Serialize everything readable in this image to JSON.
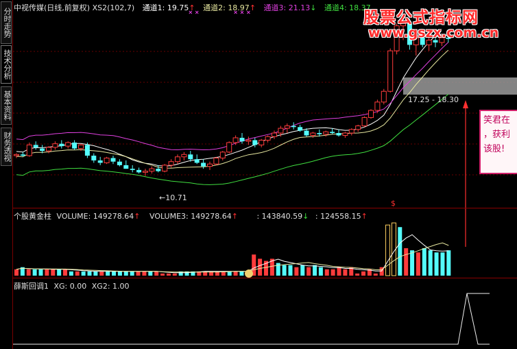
{
  "tabs": [
    {
      "label": "分时走势",
      "active": false
    },
    {
      "label": "技术分析",
      "active": true
    },
    {
      "label": "基本资料",
      "active": false
    },
    {
      "label": "财务透视",
      "active": false
    }
  ],
  "main_header": {
    "stock_name": "中视传媒(日线,前复权)",
    "indicator": "XS2(102,7)",
    "ch1_label": "通道1: ",
    "ch1_value": "19.75",
    "ch1_arrow": "↑",
    "ch2_label": "通道2: ",
    "ch2_value": "18.97",
    "ch2_arrow": "↑",
    "ch3_label": "通道3: ",
    "ch3_value": "21.13",
    "ch3_arrow": "↓",
    "ch4_label": "通道4: ",
    "ch4_value": "18.37"
  },
  "volume_header": {
    "name": "个股黄金柱",
    "vol_label": "VOLUME: ",
    "vol_value": "149278.64",
    "vol_arrow": "↑",
    "vol3_label": "VOLUME3: ",
    "vol3_value": "149278.64",
    "vol3_arrow": "↑",
    "ma1_value": ": 143840.59",
    "ma1_arrow": "↓",
    "ma2_value": ": 124558.15",
    "ma2_arrow": "↑"
  },
  "bottom_header": {
    "name": "薛斯回调1",
    "xg_label": "XG: ",
    "xg_value": "0.00",
    "xg2_label": "XG2: ",
    "xg2_value": "1.00"
  },
  "price_range_label": "17.25 - 18.30",
  "low_price_label": "←10.71",
  "dollar_mark": "$",
  "watermark": {
    "title": "股票公式指标网",
    "url": "www.gszx.com.cn"
  },
  "popup": {
    "line1": "笑君在",
    "line2": "，获利",
    "line3": "该股!"
  },
  "colors": {
    "up": "#ff3c3c",
    "down": "#54fcfc",
    "ch1": "#ffffff",
    "ch2": "#e8e8a0",
    "ch3": "#e040e0",
    "ch4": "#40e040",
    "separator": "#8a0000",
    "gray_band": "#9a9a9a"
  },
  "candles": [
    [
      13.7,
      13.9,
      13.5,
      13.8
    ],
    [
      13.8,
      14.0,
      13.6,
      13.7
    ],
    [
      13.7,
      14.8,
      13.6,
      14.6
    ],
    [
      14.6,
      14.9,
      14.2,
      14.4
    ],
    [
      14.3,
      14.6,
      13.9,
      14.1
    ],
    [
      14.1,
      14.5,
      13.9,
      14.4
    ],
    [
      14.4,
      14.9,
      14.2,
      14.7
    ],
    [
      14.7,
      15.0,
      14.3,
      14.5
    ],
    [
      14.5,
      14.9,
      14.3,
      14.8
    ],
    [
      14.8,
      15.0,
      14.2,
      14.3
    ],
    [
      14.3,
      14.7,
      14.1,
      14.6
    ],
    [
      14.6,
      14.8,
      13.5,
      13.7
    ],
    [
      13.7,
      13.9,
      13.1,
      13.3
    ],
    [
      13.3,
      13.6,
      12.9,
      13.1
    ],
    [
      13.1,
      13.6,
      13.0,
      13.5
    ],
    [
      13.5,
      13.7,
      13.0,
      13.2
    ],
    [
      13.2,
      13.4,
      12.8,
      12.9
    ],
    [
      12.9,
      13.3,
      12.6,
      12.6
    ],
    [
      12.6,
      12.9,
      12.3,
      12.5
    ],
    [
      12.5,
      12.7,
      12.2,
      12.3
    ],
    [
      12.3,
      12.6,
      12.0,
      12.4
    ],
    [
      12.4,
      12.8,
      12.2,
      12.6
    ],
    [
      12.6,
      12.9,
      12.3,
      12.4
    ],
    [
      12.4,
      13.0,
      12.3,
      12.9
    ],
    [
      12.9,
      13.4,
      12.7,
      13.2
    ],
    [
      13.2,
      13.8,
      13.0,
      13.6
    ],
    [
      13.6,
      14.0,
      13.3,
      13.8
    ],
    [
      13.8,
      14.1,
      13.2,
      13.4
    ],
    [
      13.4,
      13.8,
      13.0,
      13.1
    ],
    [
      13.1,
      13.4,
      12.6,
      12.8
    ],
    [
      12.8,
      13.2,
      12.5,
      13.0
    ],
    [
      13.0,
      13.6,
      12.9,
      13.5
    ],
    [
      13.5,
      14.1,
      13.3,
      14.0
    ],
    [
      14.0,
      14.9,
      13.9,
      14.8
    ],
    [
      14.8,
      15.4,
      14.6,
      15.2
    ],
    [
      15.2,
      15.6,
      14.7,
      14.9
    ],
    [
      14.9,
      15.3,
      14.6,
      15.0
    ],
    [
      15.0,
      15.2,
      14.4,
      14.6
    ],
    [
      14.6,
      15.1,
      14.4,
      15.0
    ],
    [
      15.0,
      15.4,
      14.8,
      15.3
    ],
    [
      15.3,
      15.8,
      15.1,
      15.6
    ],
    [
      15.6,
      16.2,
      15.3,
      16.0
    ],
    [
      16.0,
      16.4,
      15.6,
      16.2
    ],
    [
      16.2,
      16.5,
      15.9,
      16.1
    ],
    [
      16.1,
      16.3,
      15.7,
      15.8
    ],
    [
      15.8,
      16.0,
      15.3,
      15.4
    ],
    [
      15.4,
      15.7,
      15.2,
      15.6
    ],
    [
      15.6,
      15.9,
      15.3,
      15.5
    ],
    [
      15.5,
      15.8,
      15.3,
      15.7
    ],
    [
      15.7,
      16.0,
      15.5,
      15.6
    ],
    [
      15.6,
      15.9,
      15.3,
      15.4
    ],
    [
      15.4,
      15.7,
      15.2,
      15.6
    ],
    [
      15.6,
      16.0,
      15.4,
      15.9
    ],
    [
      15.9,
      16.3,
      15.7,
      16.2
    ],
    [
      16.2,
      17.0,
      16.1,
      16.9
    ],
    [
      16.9,
      17.6,
      16.8,
      17.5
    ],
    [
      17.5,
      18.4,
      17.3,
      18.2
    ],
    [
      18.2,
      19.3,
      18.0,
      19.1
    ],
    [
      19.1,
      22.7,
      19.0,
      22.5
    ],
    [
      22.5,
      24.8,
      22.2,
      24.6
    ],
    [
      24.6,
      25.0,
      23.4,
      24.8
    ],
    [
      24.8,
      25.2,
      22.6,
      23.0
    ],
    [
      23.0,
      23.9,
      22.1,
      23.6
    ],
    [
      23.6,
      23.9,
      22.8,
      23.0
    ],
    [
      23.0,
      23.6,
      22.5,
      23.4
    ],
    [
      23.4,
      23.8,
      22.8,
      23.2
    ],
    [
      23.2,
      23.9,
      22.9,
      23.6
    ],
    [
      23.6,
      23.9,
      23.2,
      23.5
    ]
  ],
  "volumes": [
    3,
    4,
    3,
    3,
    3,
    3,
    3,
    3,
    3,
    2,
    2,
    2,
    2,
    2,
    2,
    2,
    2,
    2,
    2,
    2,
    2,
    2,
    2,
    2,
    1,
    1,
    1,
    2,
    2,
    2,
    2,
    2,
    2,
    2,
    2,
    2,
    2,
    2,
    2,
    10,
    8,
    7,
    8,
    6,
    5,
    5,
    4,
    5,
    4,
    5,
    4,
    3,
    3,
    4,
    3,
    4,
    1,
    2,
    3,
    1,
    4,
    24,
    25,
    23,
    13,
    12,
    11,
    13,
    12,
    11,
    11,
    12
  ]
}
